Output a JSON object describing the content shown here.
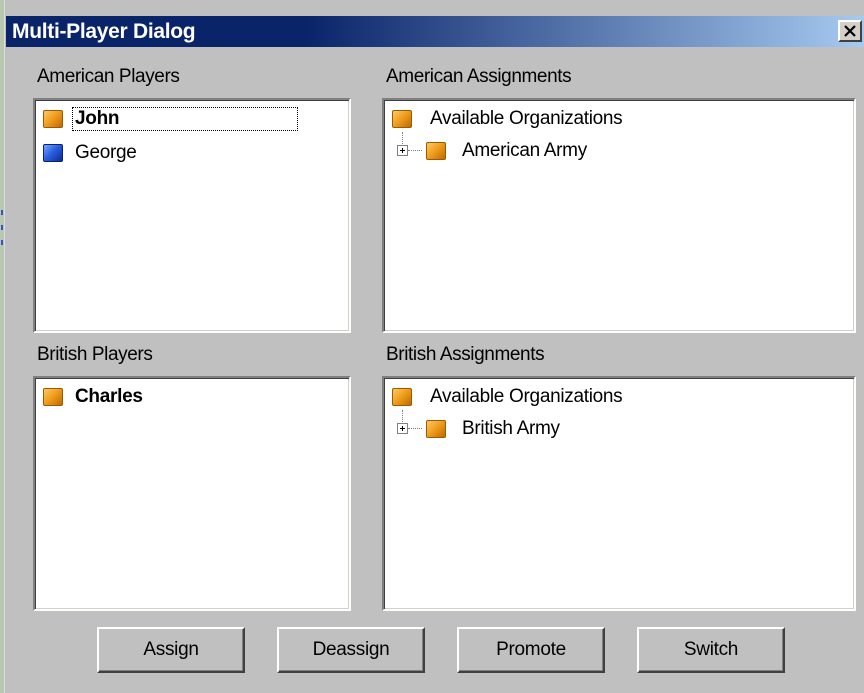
{
  "window": {
    "title": "Multi-Player Dialog",
    "close_label": "X"
  },
  "american_players": {
    "label": "American Players",
    "items": [
      {
        "name": "John",
        "icon": "orange-player-icon",
        "bold": true,
        "focused": true
      },
      {
        "name": "George",
        "icon": "blue-player-icon",
        "bold": false
      }
    ]
  },
  "american_assignments": {
    "label": "American Assignments",
    "root": "Available Organizations",
    "children": [
      "American Army"
    ]
  },
  "british_players": {
    "label": "British Players",
    "items": [
      {
        "name": "Charles",
        "icon": "orange-player-icon",
        "bold": true
      }
    ]
  },
  "british_assignments": {
    "label": "British Assignments",
    "root": "Available Organizations",
    "children": [
      "British Army"
    ]
  },
  "buttons": {
    "assign": "Assign",
    "deassign": "Deassign",
    "promote": "Promote",
    "switch": "Switch"
  },
  "colors": {
    "title_bar": "#0a246a",
    "dialog_face": "#c0c0c0",
    "org_icon": "#f0a020",
    "player_blue": "#2a60e0"
  }
}
